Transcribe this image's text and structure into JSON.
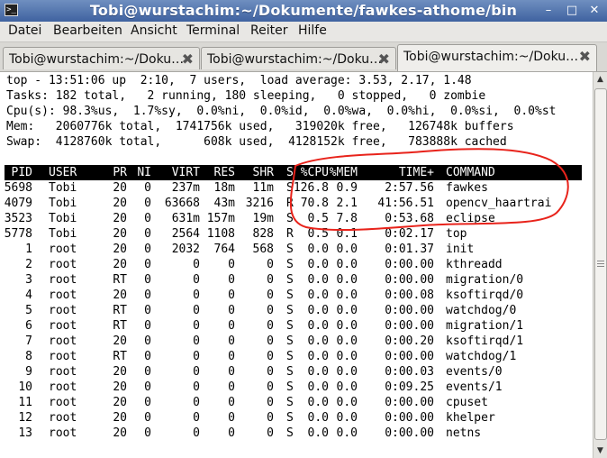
{
  "window": {
    "title": "Tobi@wurstachim:~/Dokumente/fawkes-athome/bin",
    "icon_glyph": ">_",
    "buttons": {
      "minimize": "–",
      "maximize": "□",
      "close": "✕"
    }
  },
  "menu": {
    "items": [
      "Datei",
      "Bearbeiten",
      "Ansicht",
      "Terminal",
      "Reiter",
      "Hilfe"
    ]
  },
  "tabs": [
    {
      "label": "Tobi@wurstachim:~/Doku…",
      "active": false
    },
    {
      "label": "Tobi@wurstachim:~/Doku…",
      "active": false
    },
    {
      "label": "Tobi@wurstachim:~/Doku…",
      "active": true
    }
  ],
  "tab_close_glyph": "✖",
  "summary": [
    "top - 13:51:06 up  2:10,  7 users,  load average: 3.53, 2.17, 1.48",
    "Tasks: 182 total,   2 running, 180 sleeping,   0 stopped,   0 zombie",
    "Cpu(s): 98.3%us,  1.7%sy,  0.0%ni,  0.0%id,  0.0%wa,  0.0%hi,  0.0%si,  0.0%st",
    "Mem:   2060776k total,  1741756k used,   319020k free,   126748k buffers",
    "Swap:  4128760k total,      608k used,  4128152k free,   783888k cached"
  ],
  "columns": [
    "PID",
    "USER",
    "PR",
    "NI",
    "VIRT",
    "RES",
    "SHR",
    "S",
    "%CPU",
    "%MEM",
    "TIME+",
    "COMMAND"
  ],
  "processes": [
    [
      "5698",
      "Tobi",
      "20",
      "0",
      "237m",
      "18m",
      "11m",
      "S",
      "126.8",
      "0.9",
      "2:57.56",
      "fawkes"
    ],
    [
      "4079",
      "Tobi",
      "20",
      "0",
      "63668",
      "43m",
      "3216",
      "R",
      "70.8",
      "2.1",
      "41:56.51",
      "opencv_haartrai"
    ],
    [
      "3523",
      "Tobi",
      "20",
      "0",
      "631m",
      "157m",
      "19m",
      "S",
      "0.5",
      "7.8",
      "0:53.68",
      "eclipse"
    ],
    [
      "5778",
      "Tobi",
      "20",
      "0",
      "2564",
      "1108",
      "828",
      "R",
      "0.5",
      "0.1",
      "0:02.17",
      "top"
    ],
    [
      "1",
      "root",
      "20",
      "0",
      "2032",
      "764",
      "568",
      "S",
      "0.0",
      "0.0",
      "0:01.37",
      "init"
    ],
    [
      "2",
      "root",
      "20",
      "0",
      "0",
      "0",
      "0",
      "S",
      "0.0",
      "0.0",
      "0:00.00",
      "kthreadd"
    ],
    [
      "3",
      "root",
      "RT",
      "0",
      "0",
      "0",
      "0",
      "S",
      "0.0",
      "0.0",
      "0:00.00",
      "migration/0"
    ],
    [
      "4",
      "root",
      "20",
      "0",
      "0",
      "0",
      "0",
      "S",
      "0.0",
      "0.0",
      "0:00.08",
      "ksoftirqd/0"
    ],
    [
      "5",
      "root",
      "RT",
      "0",
      "0",
      "0",
      "0",
      "S",
      "0.0",
      "0.0",
      "0:00.00",
      "watchdog/0"
    ],
    [
      "6",
      "root",
      "RT",
      "0",
      "0",
      "0",
      "0",
      "S",
      "0.0",
      "0.0",
      "0:00.00",
      "migration/1"
    ],
    [
      "7",
      "root",
      "20",
      "0",
      "0",
      "0",
      "0",
      "S",
      "0.0",
      "0.0",
      "0:00.20",
      "ksoftirqd/1"
    ],
    [
      "8",
      "root",
      "RT",
      "0",
      "0",
      "0",
      "0",
      "S",
      "0.0",
      "0.0",
      "0:00.00",
      "watchdog/1"
    ],
    [
      "9",
      "root",
      "20",
      "0",
      "0",
      "0",
      "0",
      "S",
      "0.0",
      "0.0",
      "0:00.03",
      "events/0"
    ],
    [
      "10",
      "root",
      "20",
      "0",
      "0",
      "0",
      "0",
      "S",
      "0.0",
      "0.0",
      "0:09.25",
      "events/1"
    ],
    [
      "11",
      "root",
      "20",
      "0",
      "0",
      "0",
      "0",
      "S",
      "0.0",
      "0.0",
      "0:00.00",
      "cpuset"
    ],
    [
      "12",
      "root",
      "20",
      "0",
      "0",
      "0",
      "0",
      "S",
      "0.0",
      "0.0",
      "0:00.00",
      "khelper"
    ],
    [
      "13",
      "root",
      "20",
      "0",
      "0",
      "0",
      "0",
      "S",
      "0.0",
      "0.0",
      "0:00.00",
      "netns"
    ]
  ],
  "colors": {
    "titlebar": "#4a6ca8",
    "header_row_bg": "#000000",
    "header_row_fg": "#ffffff",
    "annotation": "#e8231b"
  }
}
